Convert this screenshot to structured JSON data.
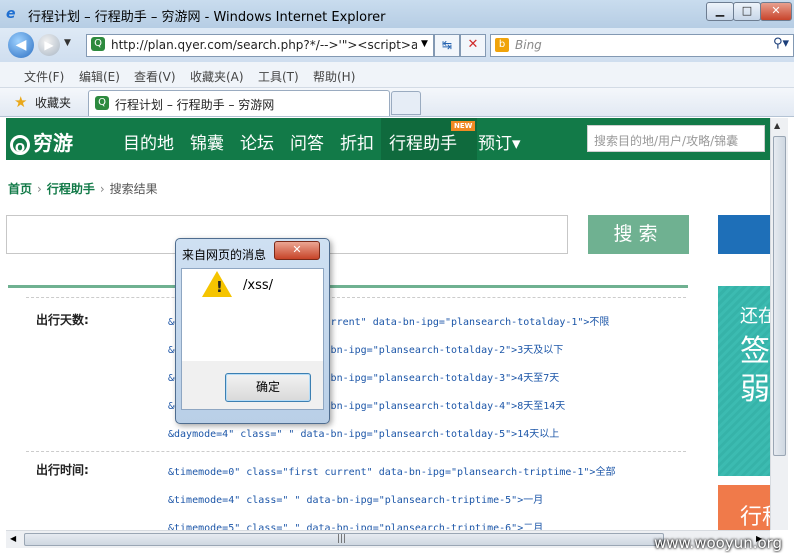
{
  "window": {
    "title": "行程计划 – 行程助手 – 穷游网 - Windows Internet Explorer",
    "min_label": "▁",
    "max_label": "□",
    "close_label": "✕"
  },
  "toolbar": {
    "address": "http://plan.qyer.com/search.php?*/-->'\"><script>al",
    "search_engine": "Bing",
    "refresh_glyph": "↹",
    "stop_glyph": "✕"
  },
  "menu": {
    "items": [
      "文件(F)",
      "编辑(E)",
      "查看(V)",
      "收藏夹(A)",
      "工具(T)",
      "帮助(H)"
    ]
  },
  "favorites": {
    "label": "收藏夹",
    "tab_title": "行程计划 – 行程助手 – 穷游网"
  },
  "site": {
    "logo_text": "穷游",
    "logo_mark": "Q",
    "nav": [
      "目的地",
      "锦囊",
      "论坛",
      "问答",
      "折扣",
      "行程助手",
      "预订▾"
    ],
    "new_badge": "NEW",
    "search_placeholder": "搜索目的地/用户/攻略/锦囊",
    "breadcrumb": {
      "home": "首页",
      "helper": "行程助手",
      "current": "搜索结果"
    },
    "search_button": "搜索",
    "filters": {
      "days_label": "出行天数:",
      "days_options": [
        "&daymode=0\" class=\"first current\" data-bn-ipg=\"plansearch-totalday-1\">不限",
        "&daymode=1\" class=\" \" data-bn-ipg=\"plansearch-totalday-2\">3天及以下",
        "&daymode=2\" class=\" \" data-bn-ipg=\"plansearch-totalday-3\">4天至7天",
        "&daymode=3\" class=\" \" data-bn-ipg=\"plansearch-totalday-4\">8天至14天",
        "&daymode=4\" class=\" \" data-bn-ipg=\"plansearch-totalday-5\">14天以上"
      ],
      "time_label": "出行时间:",
      "time_options": [
        "&timemode=0\" class=\"first current\" data-bn-ipg=\"plansearch-triptime-1\">全部",
        "&timemode=4\" class=\" \" data-bn-ipg=\"plansearch-triptime-5\">一月",
        "&timemode=5\" class=\" \" data-bn-ipg=\"plansearch-triptime-6\">二月"
      ]
    },
    "ad": {
      "line1": "还在",
      "line2": "签",
      "line3": "弱",
      "orange_text": "行程"
    }
  },
  "dialog": {
    "title": "来自网页的消息",
    "close_label": "✕",
    "warning_mark": "!",
    "message": "/xss/",
    "ok_label": "确定"
  },
  "watermark": "www.wooyun.org",
  "colors": {
    "site_green": "#127a48",
    "search_button": "#6fb191",
    "ad_teal": "#36b3a9",
    "ad_orange": "#f07a4a"
  }
}
